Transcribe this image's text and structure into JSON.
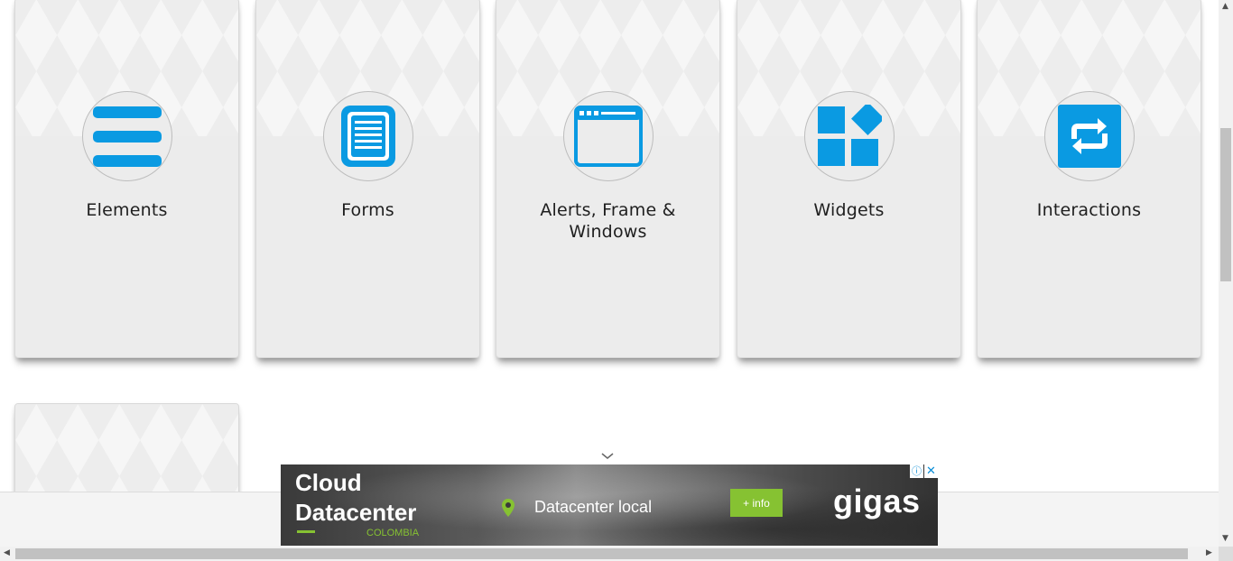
{
  "cards": [
    {
      "title": "Elements",
      "icon": "hamburger-list-icon"
    },
    {
      "title": "Forms",
      "icon": "document-form-icon"
    },
    {
      "title": "Alerts, Frame & Windows",
      "icon": "browser-window-icon"
    },
    {
      "title": "Widgets",
      "icon": "widget-blocks-icon"
    },
    {
      "title": "Interactions",
      "icon": "swap-arrows-icon"
    }
  ],
  "colors": {
    "icon_blue": "#0a9ae2",
    "card_bg": "#ececec",
    "ad_green": "#86c232"
  },
  "ad": {
    "headline_line1": "Cloud",
    "headline_line2": "Datacenter",
    "country": "COLOMBIA",
    "location": "Datacenter local",
    "button_label": "+ info",
    "brand": "gigas",
    "info_icon": "ⓘ",
    "close_icon": "✕"
  }
}
